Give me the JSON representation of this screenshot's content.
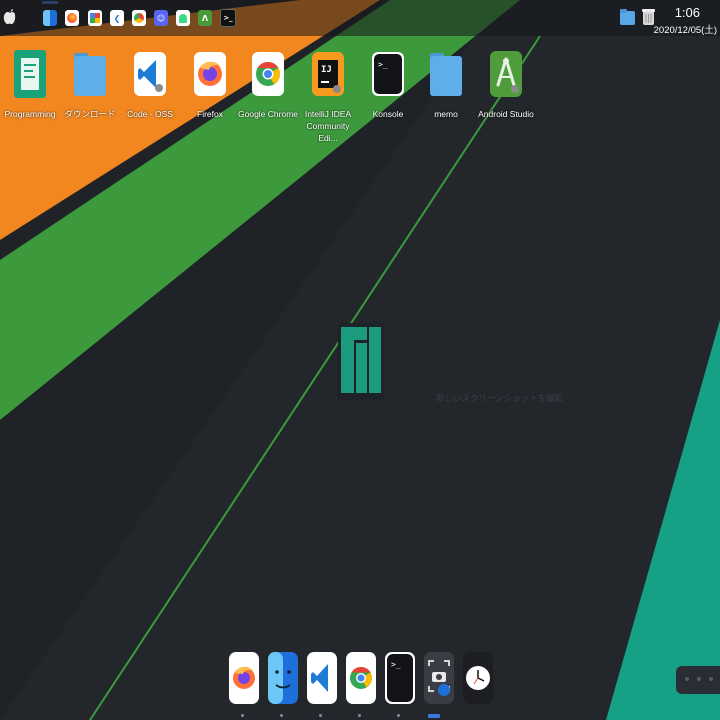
{
  "top_panel": {
    "tasks": [
      {
        "icon": "finder-icon"
      },
      {
        "icon": "firefox-icon"
      },
      {
        "icon": "pinwheel-icon"
      },
      {
        "icon": "vscode-icon"
      },
      {
        "icon": "chrome-icon"
      },
      {
        "icon": "discord-icon"
      },
      {
        "icon": "android-icon"
      },
      {
        "icon": "terminal-icon"
      }
    ],
    "clock_time": "1:06",
    "clock_date": "2020/12/05(土)"
  },
  "desktop_icons": [
    {
      "label": "Programming",
      "icon": "programming-icon"
    },
    {
      "label": "ダウンロード",
      "icon": "folder-icon"
    },
    {
      "label": "Code - OSS",
      "icon": "vscode-icon"
    },
    {
      "label": "Firefox",
      "icon": "firefox-icon"
    },
    {
      "label": "Google Chrome",
      "icon": "chrome-icon"
    },
    {
      "label": "IntelliJ IDEA Community Edi...",
      "icon": "intellij-icon"
    },
    {
      "label": "Konsole",
      "icon": "terminal-icon"
    },
    {
      "label": "memo",
      "icon": "folder-icon"
    },
    {
      "label": "Android Studio",
      "icon": "android-studio-icon"
    }
  ],
  "center": {
    "caption": "新しいスクリーンショットを撮影"
  },
  "dock": [
    {
      "icon": "firefox-icon"
    },
    {
      "icon": "finder-icon"
    },
    {
      "icon": "vscode-icon"
    },
    {
      "icon": "chrome-icon"
    },
    {
      "icon": "terminal-icon"
    },
    {
      "icon": "screenshot-icon"
    },
    {
      "icon": "clock-icon"
    }
  ],
  "colors": {
    "orange": "#f2871f",
    "green": "#3c9a3c",
    "teal": "#16a085",
    "manjaro": "#1b9c7e",
    "background": "#1f2226"
  }
}
